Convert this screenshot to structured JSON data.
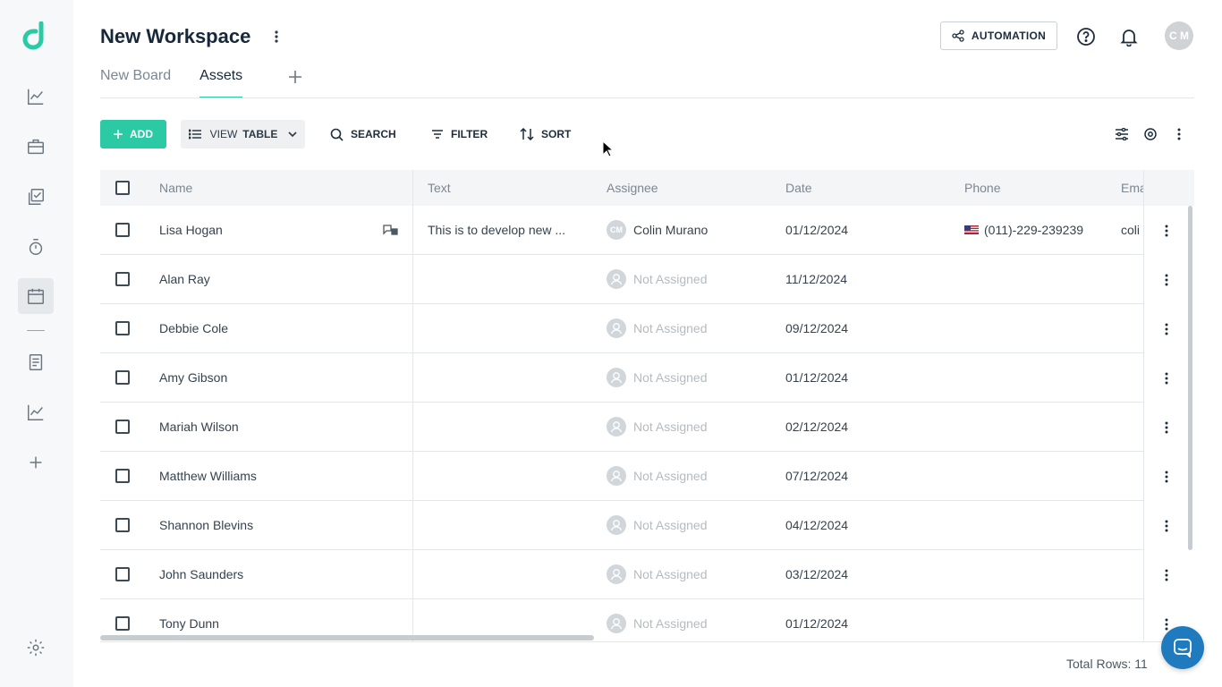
{
  "header": {
    "workspace_title": "New Workspace",
    "tabs": [
      {
        "label": "New Board",
        "active": false
      },
      {
        "label": "Assets",
        "active": true
      }
    ],
    "automation_label": "AUTOMATION",
    "user_initials": "C M"
  },
  "toolbar": {
    "add_label": "ADD",
    "view_prefix": "VIEW",
    "view_value": "TABLE",
    "search_label": "SEARCH",
    "filter_label": "FILTER",
    "sort_label": "SORT"
  },
  "table": {
    "columns": [
      "Name",
      "Text",
      "Assignee",
      "Date",
      "Phone",
      "Email"
    ],
    "rows": [
      {
        "name": "Lisa Hogan",
        "text": "This is to develop new ...",
        "assignee": "Colin Murano",
        "assignee_initials": "CM",
        "assigned": true,
        "date": "01/12/2024",
        "phone": "(011)-229-239239",
        "email": "coli"
      },
      {
        "name": "Alan Ray",
        "text": "",
        "assignee": "Not Assigned",
        "assigned": false,
        "date": "11/12/2024",
        "phone": "",
        "email": ""
      },
      {
        "name": "Debbie Cole",
        "text": "",
        "assignee": "Not Assigned",
        "assigned": false,
        "date": "09/12/2024",
        "phone": "",
        "email": ""
      },
      {
        "name": "Amy Gibson",
        "text": "",
        "assignee": "Not Assigned",
        "assigned": false,
        "date": "01/12/2024",
        "phone": "",
        "email": ""
      },
      {
        "name": "Mariah Wilson",
        "text": "",
        "assignee": "Not Assigned",
        "assigned": false,
        "date": "02/12/2024",
        "phone": "",
        "email": ""
      },
      {
        "name": "Matthew Williams",
        "text": "",
        "assignee": "Not Assigned",
        "assigned": false,
        "date": "07/12/2024",
        "phone": "",
        "email": ""
      },
      {
        "name": "Shannon Blevins",
        "text": "",
        "assignee": "Not Assigned",
        "assigned": false,
        "date": "04/12/2024",
        "phone": "",
        "email": ""
      },
      {
        "name": "John Saunders",
        "text": "",
        "assignee": "Not Assigned",
        "assigned": false,
        "date": "03/12/2024",
        "phone": "",
        "email": ""
      },
      {
        "name": "Tony Dunn",
        "text": "",
        "assignee": "Not Assigned",
        "assigned": false,
        "date": "01/12/2024",
        "phone": "",
        "email": ""
      }
    ]
  },
  "footer": {
    "total_rows_label": "Total Rows: 11"
  },
  "colors": {
    "accent": "#2bcaa5",
    "chat": "#1f7bbd"
  }
}
